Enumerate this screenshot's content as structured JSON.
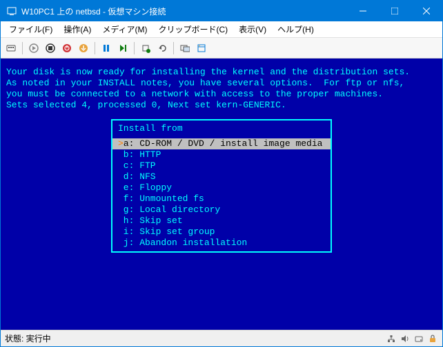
{
  "titlebar": {
    "title": "W10PC1 上の netbsd - 仮想マシン接続"
  },
  "menubar": {
    "file": "ファイル(F)",
    "action": "操作(A)",
    "media": "メディア(M)",
    "clipboard": "クリップボード(C)",
    "view": "表示(V)",
    "help": "ヘルプ(H)"
  },
  "terminal": {
    "line1": "Your disk is now ready for installing the kernel and the distribution sets.",
    "line2": "As noted in your INSTALL notes, you have several options.  For ftp or nfs,",
    "line3": "you must be connected to a network with access to the proper machines.",
    "line4": "",
    "line5": "Sets selected 4, processed 0, Next set kern-GENERIC.",
    "menutitle": "Install from",
    "items": [
      {
        "key": "a",
        "label": "CD-ROM / DVD / install image media",
        "selected": true
      },
      {
        "key": "b",
        "label": "HTTP",
        "selected": false
      },
      {
        "key": "c",
        "label": "FTP",
        "selected": false
      },
      {
        "key": "d",
        "label": "NFS",
        "selected": false
      },
      {
        "key": "e",
        "label": "Floppy",
        "selected": false
      },
      {
        "key": "f",
        "label": "Unmounted fs",
        "selected": false
      },
      {
        "key": "g",
        "label": "Local directory",
        "selected": false
      },
      {
        "key": "h",
        "label": "Skip set",
        "selected": false
      },
      {
        "key": "i",
        "label": "Skip set group",
        "selected": false
      },
      {
        "key": "j",
        "label": "Abandon installation",
        "selected": false
      }
    ]
  },
  "statusbar": {
    "text": "状態: 実行中"
  }
}
